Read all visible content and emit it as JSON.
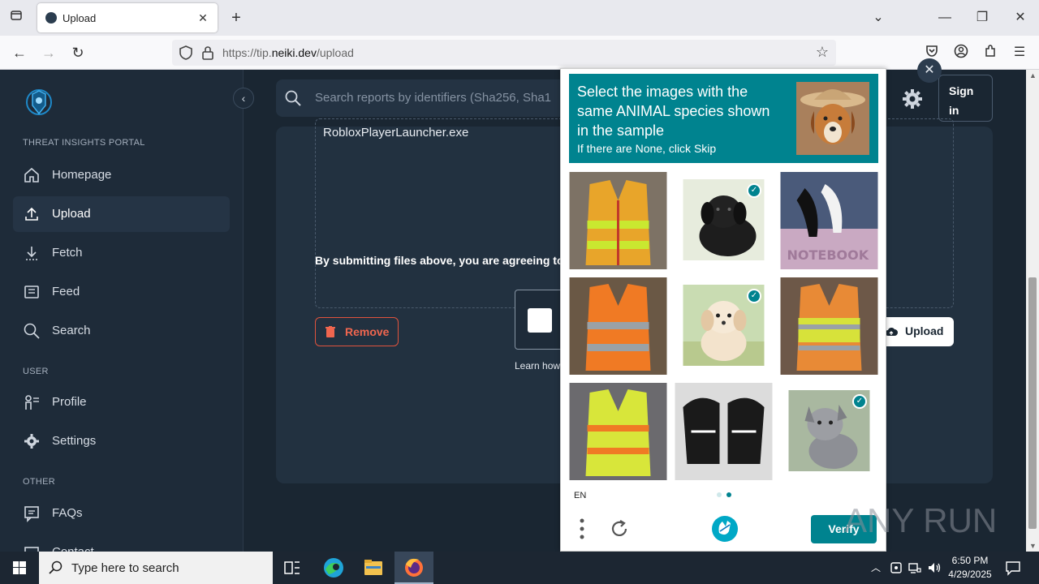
{
  "browser": {
    "tab_title": "Upload",
    "url_prefix": "https://tip.",
    "url_domain": "neiki.dev",
    "url_path": "/upload"
  },
  "sidebar": {
    "section_portal": "THREAT INSIGHTS PORTAL",
    "section_user": "USER",
    "section_other": "OTHER",
    "items": [
      {
        "label": "Homepage",
        "icon": "home-icon"
      },
      {
        "label": "Upload",
        "icon": "upload-icon",
        "active": true
      },
      {
        "label": "Fetch",
        "icon": "download-icon"
      },
      {
        "label": "Feed",
        "icon": "feed-icon"
      },
      {
        "label": "Search",
        "icon": "search-icon"
      },
      {
        "label": "Profile",
        "icon": "profile-icon"
      },
      {
        "label": "Settings",
        "icon": "gear-icon"
      },
      {
        "label": "FAQs",
        "icon": "faq-icon"
      },
      {
        "label": "Contact",
        "icon": "contact-icon"
      }
    ]
  },
  "header": {
    "search_placeholder": "Search reports by identifiers (Sha256, Sha1",
    "signin_line1": "Sign",
    "signin_line2": "in"
  },
  "main": {
    "file_name": "RobloxPlayerLauncher.exe",
    "agree_text": "By submitting files above, you are agreeing to",
    "remove_label": "Remove",
    "upload_label": "Upload",
    "learn_how": "Learn how"
  },
  "captcha": {
    "prompt": "Select the images with the same ANIMAL species shown in the sample",
    "sub_prompt": "If there are None, click Skip",
    "language": "EN",
    "verify_label": "Verify",
    "page_count": 2,
    "current_page": 2,
    "accent_color": "#00838f",
    "tiles": [
      {
        "subject": "safety vest",
        "selected": false
      },
      {
        "subject": "black puppy",
        "selected": true
      },
      {
        "subject": "notebook",
        "selected": false
      },
      {
        "subject": "safety vest",
        "selected": false
      },
      {
        "subject": "white puppy",
        "selected": true
      },
      {
        "subject": "safety vest",
        "selected": false
      },
      {
        "subject": "safety vest",
        "selected": false
      },
      {
        "subject": "shoes",
        "selected": false
      },
      {
        "subject": "grey puppy",
        "selected": true
      }
    ],
    "watermark_text": "NOTEBOOK"
  },
  "watermark": "ANY RUN",
  "taskbar": {
    "search_placeholder": "Type here to search",
    "time": "6:50 PM",
    "date": "4/29/2025"
  }
}
